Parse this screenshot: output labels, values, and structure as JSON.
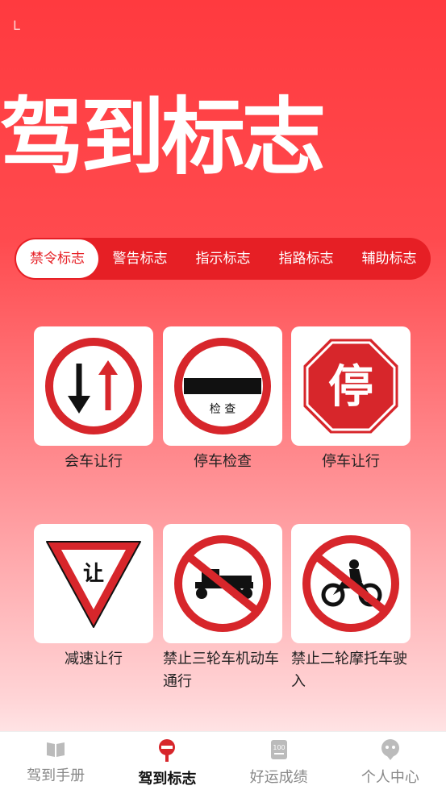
{
  "status": {
    "text": "L"
  },
  "hero": {
    "title": "驾到标志"
  },
  "tabs": [
    {
      "label": "禁令标志"
    },
    {
      "label": "警告标志"
    },
    {
      "label": "指示标志"
    },
    {
      "label": "指路标志"
    },
    {
      "label": "辅助标志"
    }
  ],
  "signs": [
    {
      "label": "会车让行",
      "icon": "yield-oncoming-sign-icon"
    },
    {
      "label": "停车检查",
      "icon": "stop-check-sign-icon",
      "sign_text": "检 查"
    },
    {
      "label": "停车让行",
      "icon": "stop-sign-icon",
      "sign_text": "停"
    },
    {
      "label": "减速让行",
      "icon": "slow-yield-sign-icon",
      "sign_text": "让"
    },
    {
      "label": "禁止三轮车机动车通行",
      "icon": "no-tricycle-sign-icon"
    },
    {
      "label": "禁止二轮摩托车驶入",
      "icon": "no-motorcycle-sign-icon"
    }
  ],
  "nav": [
    {
      "label": "驾到手册",
      "icon": "book-icon"
    },
    {
      "label": "驾到标志",
      "icon": "sign-icon"
    },
    {
      "label": "好运成绩",
      "icon": "score-icon"
    },
    {
      "label": "个人中心",
      "icon": "profile-icon"
    }
  ],
  "colors": {
    "brand": "#e61f25",
    "accent_red": "#d7262b"
  }
}
